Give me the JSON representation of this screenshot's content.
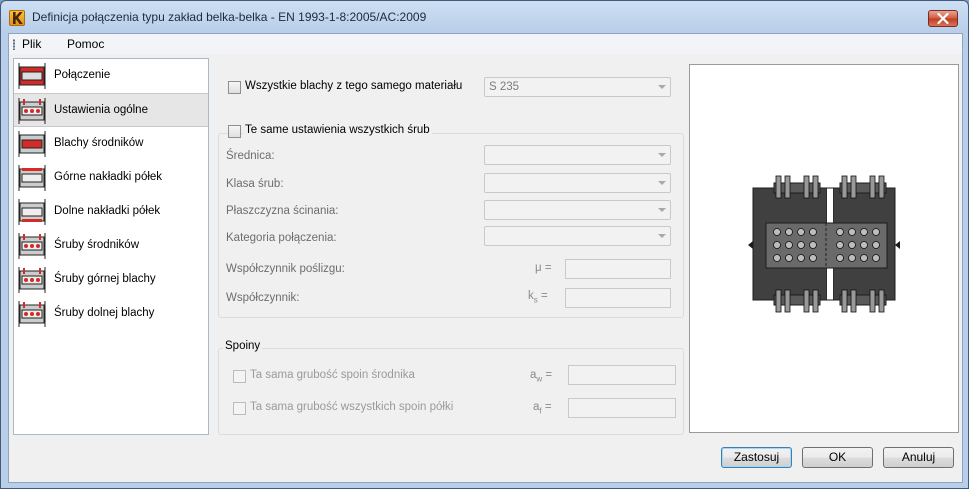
{
  "window": {
    "title": "Definicja połączenia typu zakład belka-belka - EN 1993-1-8:2005/AC:2009",
    "app_icon": "app-k-icon",
    "close_icon": "close-icon"
  },
  "menu": {
    "file": "Plik",
    "help": "Pomoc"
  },
  "nav": {
    "items": [
      {
        "label": "Połączenie",
        "icon": "connection-icon",
        "selected": false
      },
      {
        "label": "Ustawienia ogólne",
        "icon": "general-settings-icon",
        "selected": true
      },
      {
        "label": "Blachy środników",
        "icon": "web-plates-icon",
        "selected": false
      },
      {
        "label": "Górne nakładki półek",
        "icon": "top-flange-plates-icon",
        "selected": false
      },
      {
        "label": "Dolne nakładki półek",
        "icon": "bottom-flange-plates-icon",
        "selected": false
      },
      {
        "label": "Śruby środników",
        "icon": "web-bolts-icon",
        "selected": false
      },
      {
        "label": "Śruby górnej blachy",
        "icon": "top-plate-bolts-icon",
        "selected": false
      },
      {
        "label": "Śruby dolnej blachy",
        "icon": "bottom-plate-bolts-icon",
        "selected": false
      }
    ]
  },
  "material": {
    "checkbox_label": "Wszystkie blachy z tego samego materiału",
    "value": "S 235"
  },
  "bolts": {
    "checkbox_label": "Te same ustawienia wszystkich śrub",
    "diameter_label": "Średnica:",
    "class_label": "Klasa śrub:",
    "shear_plane_label": "Płaszczyzna ścinania:",
    "category_label": "Kategoria połączenia:",
    "friction_label": "Współczynnik poślizgu:",
    "friction_symbol": "μ =",
    "coef_label": "Współczynnik:",
    "coef_symbol_main": "k",
    "coef_symbol_sub": "s",
    "coef_symbol_eq": " ="
  },
  "welds": {
    "group_title": "Spoiny",
    "web_label": "Ta sama grubość spoin środnika",
    "web_symbol_main": "a",
    "web_symbol_sub": "w",
    "web_symbol_eq": " =",
    "flange_label": "Ta sama grubość wszystkich spoin półki",
    "flange_symbol_main": "a",
    "flange_symbol_sub": "f",
    "flange_symbol_eq": " ="
  },
  "buttons": {
    "apply": "Zastosuj",
    "ok": "OK",
    "cancel": "Anuluj"
  }
}
